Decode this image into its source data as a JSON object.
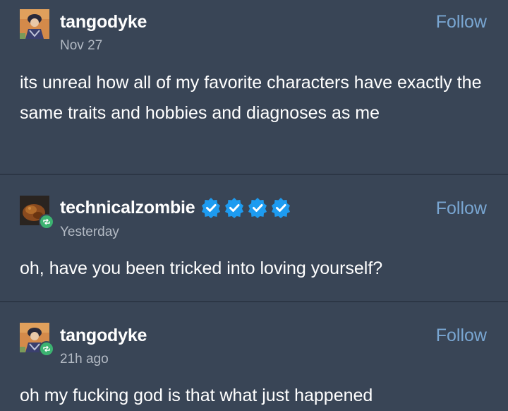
{
  "posts": [
    {
      "username": "tangodyke",
      "timestamp": "Nov 27",
      "follow_label": "Follow",
      "body": "its unreal how all of my favorite characters have exactly the same traits and hobbies and diagnoses as me",
      "reblog": false
    },
    {
      "username": "technicalzombie",
      "timestamp": "Yesterday",
      "follow_label": "Follow",
      "body": "oh, have you been tricked into loving yourself?",
      "reblog": true,
      "verified_badges": 4
    },
    {
      "username": "tangodyke",
      "timestamp": "21h ago",
      "follow_label": "Follow",
      "body": "oh my fucking god is that what just happened",
      "reblog": true
    }
  ],
  "colors": {
    "background": "#394556",
    "divider": "#2c3645",
    "follow": "#79a6d2",
    "timestamp": "#b3bac4",
    "reblog_badge": "#3cb371",
    "verified_badge": "#1d9bf0"
  },
  "icons": {
    "reblog": "reblog-icon",
    "verified": "verified-badge-icon"
  }
}
